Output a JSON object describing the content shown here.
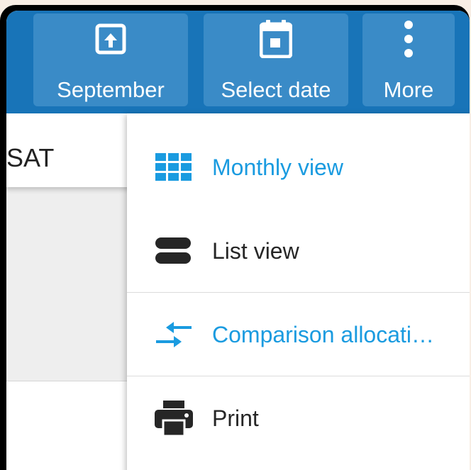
{
  "toolbar": {
    "month_label": "September",
    "select_date_label": "Select date",
    "more_label": "More"
  },
  "calendar": {
    "day_header": "SAT"
  },
  "menu": {
    "items": [
      {
        "label": "Monthly view",
        "icon": "grid-icon",
        "color": "#1a9be0"
      },
      {
        "label": "List view",
        "icon": "list-icon",
        "color": "#262626"
      },
      {
        "label": "Comparison allocati…",
        "icon": "compare-arrows-icon",
        "color": "#1a9be0"
      },
      {
        "label": "Print",
        "icon": "printer-icon",
        "color": "#262626"
      }
    ]
  },
  "colors": {
    "toolbar": "#1874b8",
    "toolbar_button": "#3a8bc7",
    "accent": "#1a9be0"
  }
}
